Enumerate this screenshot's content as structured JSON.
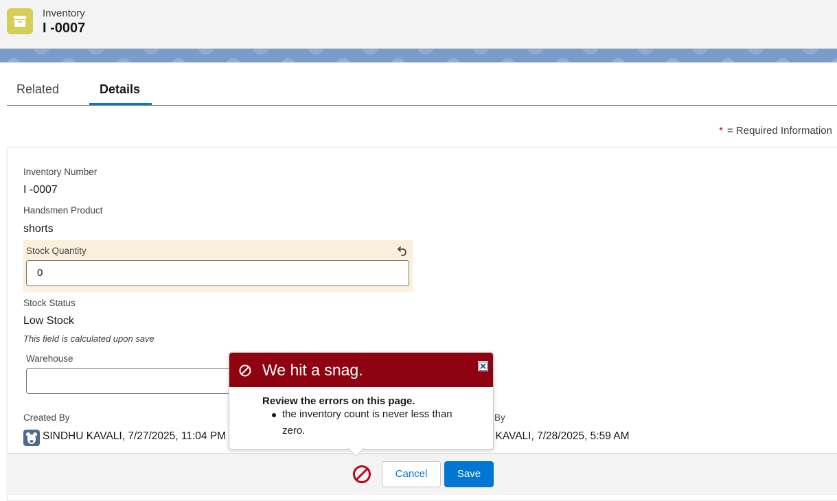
{
  "header": {
    "object_type": "Inventory",
    "record_name": "I -0007",
    "icon": "archive-box-icon",
    "icon_color": "#d5cf5a"
  },
  "tabs": [
    {
      "label": "Related",
      "active": false
    },
    {
      "label": "Details",
      "active": true
    }
  ],
  "required_note": {
    "star": "*",
    "text": "= Required Information"
  },
  "fields": {
    "inventory_number": {
      "label": "Inventory Number",
      "value": "I -0007"
    },
    "handsmen_product": {
      "label": "Handsmen Product",
      "value": "shorts"
    },
    "stock_quantity": {
      "label": "Stock Quantity",
      "value": "0"
    },
    "stock_status": {
      "label": "Stock Status",
      "value": "Low Stock",
      "hint": "This field is calculated upon save"
    },
    "warehouse": {
      "label": "Warehouse",
      "value": ""
    },
    "created_by": {
      "label": "Created By",
      "user": "SINDHU KAVALI",
      "timestamp": ", 7/27/2025, 11:04 PM"
    },
    "modified_by": {
      "label": "By",
      "user": "U KAVALI",
      "timestamp": ", 7/28/2025, 5:59 AM"
    }
  },
  "footer": {
    "cancel_label": "Cancel",
    "save_label": "Save"
  },
  "error_popover": {
    "title": "We hit a snag.",
    "subtitle": "Review the errors on this page.",
    "errors": [
      "the inventory count is never less than zero."
    ],
    "header_color": "#8e030f"
  },
  "colors": {
    "brand": "#0176d3",
    "edited_field": "#faf0dc",
    "error": "#ba0517"
  }
}
